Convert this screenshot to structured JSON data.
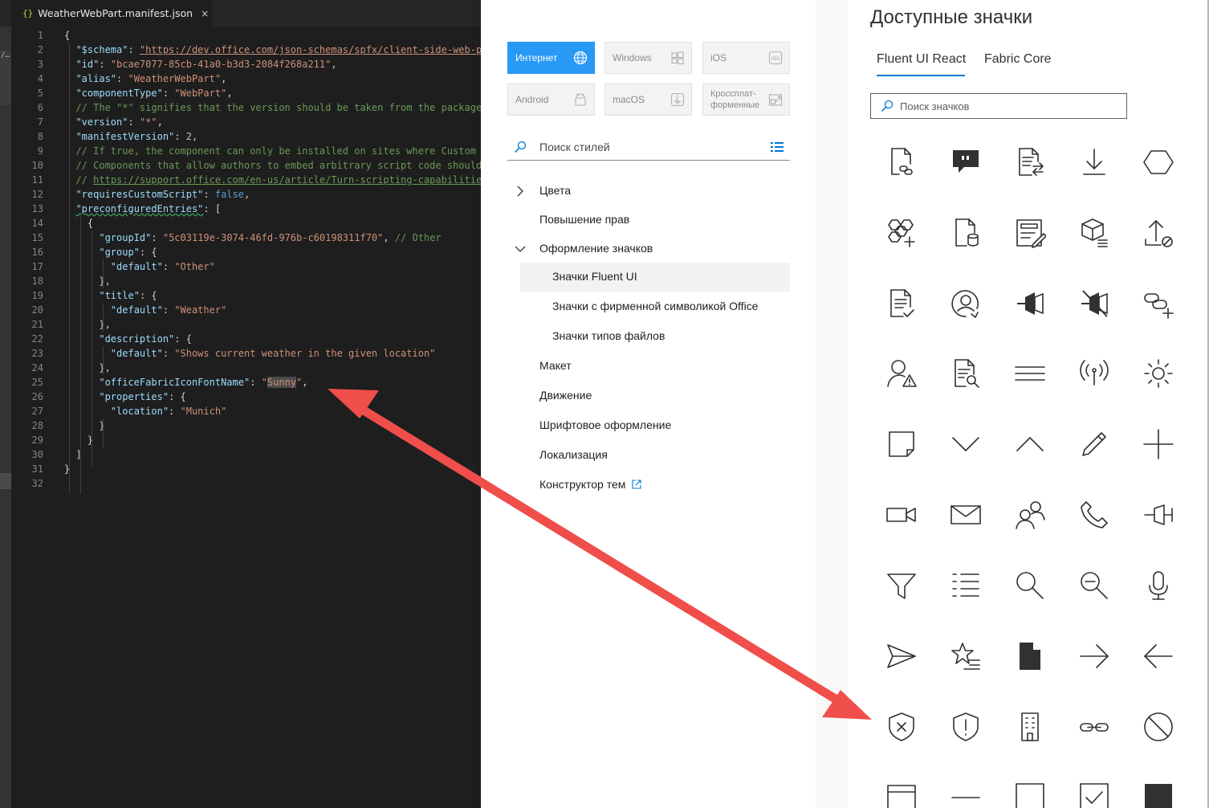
{
  "editor": {
    "tab": {
      "icon": "{}",
      "title": "WeatherWebPart.manifest.json",
      "close": "×"
    },
    "activity_mark": "/…",
    "lines": [
      {
        "n": "1",
        "t": [
          [
            "pun",
            "{"
          ]
        ]
      },
      {
        "n": "2",
        "t": [
          [
            "pun",
            "  "
          ],
          [
            "key",
            "\"$schema\""
          ],
          [
            "pun",
            ": "
          ],
          [
            "lnk",
            "\"https://dev.office.com/json-schemas/spfx/client-side-web-p"
          ]
        ]
      },
      {
        "n": "3",
        "t": [
          [
            "pun",
            "  "
          ],
          [
            "key",
            "\"id\""
          ],
          [
            "pun",
            ": "
          ],
          [
            "str",
            "\"bcae7077-85cb-41a0-b3d3-2084f268a211\""
          ],
          [
            "pun",
            ","
          ]
        ]
      },
      {
        "n": "4",
        "t": [
          [
            "pun",
            "  "
          ],
          [
            "key",
            "\"alias\""
          ],
          [
            "pun",
            ": "
          ],
          [
            "str",
            "\"WeatherWebPart\""
          ],
          [
            "pun",
            ","
          ]
        ]
      },
      {
        "n": "5",
        "t": [
          [
            "pun",
            "  "
          ],
          [
            "key",
            "\"componentType\""
          ],
          [
            "pun",
            ": "
          ],
          [
            "str",
            "\"WebPart\""
          ],
          [
            "pun",
            ","
          ]
        ]
      },
      {
        "n": "6",
        "t": [
          [
            "pun",
            "  "
          ],
          [
            "cmt",
            "// The \"*\" signifies that the version should be taken from the package"
          ]
        ]
      },
      {
        "n": "7",
        "t": [
          [
            "pun",
            "  "
          ],
          [
            "key",
            "\"version\""
          ],
          [
            "pun",
            ": "
          ],
          [
            "str",
            "\"*\""
          ],
          [
            "pun",
            ","
          ]
        ]
      },
      {
        "n": "8",
        "t": [
          [
            "pun",
            "  "
          ],
          [
            "key",
            "\"manifestVersion\""
          ],
          [
            "pun",
            ": "
          ],
          [
            "num",
            "2"
          ],
          [
            "pun",
            ","
          ]
        ]
      },
      {
        "n": "9",
        "t": [
          [
            "pun",
            "  "
          ],
          [
            "cmt",
            "// If true, the component can only be installed on sites where Custom"
          ]
        ]
      },
      {
        "n": "10",
        "t": [
          [
            "pun",
            "  "
          ],
          [
            "cmt",
            "// Components that allow authors to embed arbitrary script code should"
          ]
        ]
      },
      {
        "n": "11",
        "t": [
          [
            "pun",
            "  "
          ],
          [
            "cmt",
            "// "
          ],
          [
            "cmtlnk",
            "https://support.office.com/en-us/article/Turn-scripting-capabilitie"
          ]
        ]
      },
      {
        "n": "12",
        "t": [
          [
            "pun",
            "  "
          ],
          [
            "key",
            "\"requiresCustomScript\""
          ],
          [
            "pun",
            ": "
          ],
          [
            "bool",
            "false"
          ],
          [
            "pun",
            ","
          ]
        ]
      },
      {
        "n": "13",
        "t": [
          [
            "pun",
            "  "
          ],
          [
            "keysq",
            "\"preconfiguredEntries\""
          ],
          [
            "pun",
            ": ["
          ]
        ]
      },
      {
        "n": "14",
        "t": [
          [
            "pun",
            "    {"
          ]
        ]
      },
      {
        "n": "15",
        "t": [
          [
            "pun",
            "      "
          ],
          [
            "key",
            "\"groupId\""
          ],
          [
            "pun",
            ": "
          ],
          [
            "str",
            "\"5c03119e-3074-46fd-976b-c60198311f70\""
          ],
          [
            "pun",
            ", "
          ],
          [
            "cmt",
            "// Other"
          ]
        ]
      },
      {
        "n": "16",
        "t": [
          [
            "pun",
            "      "
          ],
          [
            "key",
            "\"group\""
          ],
          [
            "pun",
            ": {"
          ]
        ]
      },
      {
        "n": "17",
        "t": [
          [
            "pun",
            "        "
          ],
          [
            "key",
            "\"default\""
          ],
          [
            "pun",
            ": "
          ],
          [
            "str",
            "\"Other\""
          ]
        ]
      },
      {
        "n": "18",
        "t": [
          [
            "pun",
            "      },"
          ]
        ]
      },
      {
        "n": "19",
        "t": [
          [
            "pun",
            "      "
          ],
          [
            "key",
            "\"title\""
          ],
          [
            "pun",
            ": {"
          ]
        ]
      },
      {
        "n": "20",
        "t": [
          [
            "pun",
            "        "
          ],
          [
            "key",
            "\"default\""
          ],
          [
            "pun",
            ": "
          ],
          [
            "str",
            "\"Weather\""
          ]
        ]
      },
      {
        "n": "21",
        "t": [
          [
            "pun",
            "      },"
          ]
        ]
      },
      {
        "n": "22",
        "t": [
          [
            "pun",
            "      "
          ],
          [
            "key",
            "\"description\""
          ],
          [
            "pun",
            ": {"
          ]
        ]
      },
      {
        "n": "23",
        "t": [
          [
            "pun",
            "        "
          ],
          [
            "key",
            "\"default\""
          ],
          [
            "pun",
            ": "
          ],
          [
            "str",
            "\"Shows current weather in the given location\""
          ]
        ]
      },
      {
        "n": "24",
        "t": [
          [
            "pun",
            "      },"
          ]
        ]
      },
      {
        "n": "25",
        "t": [
          [
            "pun",
            "      "
          ],
          [
            "key",
            "\"officeFabricIconFontName\""
          ],
          [
            "pun",
            ": "
          ],
          [
            "str",
            "\""
          ],
          [
            "strhl",
            "Sunny"
          ],
          [
            "str",
            "\""
          ],
          [
            "pun",
            ","
          ]
        ]
      },
      {
        "n": "26",
        "t": [
          [
            "pun",
            "      "
          ],
          [
            "key",
            "\"properties\""
          ],
          [
            "pun",
            ": {"
          ]
        ]
      },
      {
        "n": "27",
        "t": [
          [
            "pun",
            "        "
          ],
          [
            "key",
            "\"location\""
          ],
          [
            "pun",
            ": "
          ],
          [
            "str",
            "\"Munich\""
          ]
        ]
      },
      {
        "n": "28",
        "t": [
          [
            "pun",
            "      }"
          ]
        ]
      },
      {
        "n": "29",
        "t": [
          [
            "pun",
            "    }"
          ]
        ]
      },
      {
        "n": "30",
        "t": [
          [
            "pun",
            "  ]"
          ]
        ]
      },
      {
        "n": "31",
        "t": [
          [
            "pun",
            "}"
          ]
        ]
      },
      {
        "n": "32",
        "t": [
          [
            "pun",
            ""
          ]
        ]
      }
    ]
  },
  "style_panel": {
    "platforms": [
      {
        "name": "platform-web",
        "label": "Интернет",
        "icon": "globe-icon",
        "active": true
      },
      {
        "name": "platform-windows",
        "label": "Windows",
        "icon": "windows-icon",
        "active": false
      },
      {
        "name": "platform-ios",
        "label": "iOS",
        "icon": "ios-icon",
        "active": false
      },
      {
        "name": "platform-android",
        "label": "Android",
        "icon": "android-icon",
        "active": false
      },
      {
        "name": "platform-macos",
        "label": "macOS",
        "icon": "macos-icon",
        "active": false
      },
      {
        "name": "platform-cross",
        "label": "Кроссплат-\nформенные",
        "icon": "cross-platform-icon",
        "active": false
      }
    ],
    "search": {
      "placeholder": "Поиск стилей"
    },
    "nav": [
      {
        "id": "colors",
        "label": "Цвета",
        "chevron": "right",
        "level": 0,
        "selected": false
      },
      {
        "id": "elevation",
        "label": "Повышение прав",
        "chevron": "",
        "level": 0,
        "selected": false
      },
      {
        "id": "iconography",
        "label": "Оформление значков",
        "chevron": "down",
        "level": 0,
        "selected": false
      },
      {
        "id": "fluent-icons",
        "label": "Значки Fluent UI",
        "chevron": "",
        "level": 1,
        "selected": true
      },
      {
        "id": "office-brand-icons",
        "label": "Значки с фирменной символикой Office",
        "chevron": "",
        "level": 1,
        "selected": false
      },
      {
        "id": "file-type-icons",
        "label": "Значки типов файлов",
        "chevron": "",
        "level": 1,
        "selected": false
      },
      {
        "id": "layout",
        "label": "Макет",
        "chevron": "",
        "level": 0,
        "selected": false
      },
      {
        "id": "motion",
        "label": "Движение",
        "chevron": "",
        "level": 0,
        "selected": false
      },
      {
        "id": "typography",
        "label": "Шрифтовое оформление",
        "chevron": "",
        "level": 0,
        "selected": false
      },
      {
        "id": "localization",
        "label": "Локализация",
        "chevron": "",
        "level": 0,
        "selected": false
      },
      {
        "id": "theme-designer",
        "label": "Конструктор тем",
        "chevron": "",
        "level": 0,
        "selected": false,
        "external": true
      }
    ]
  },
  "icons_panel": {
    "title": "Доступные значки",
    "tabs": [
      {
        "label": "Fluent UI React",
        "active": true
      },
      {
        "label": "Fabric Core",
        "active": false
      }
    ],
    "search": {
      "placeholder": "Поиск значков"
    },
    "grid": [
      [
        "page-link-icon",
        "chat-comment-icon",
        "page-swap-icon",
        "download-icon",
        "hexagon-icon"
      ],
      [
        "shapes-add-icon",
        "page-database-icon",
        "edit-form-icon",
        "package-list-icon",
        "upload-blocked-icon"
      ],
      [
        "document-approval-icon",
        "contact-sync-icon",
        "pin-icon",
        "unpin-icon",
        "link-add-icon"
      ],
      [
        "person-warning-icon",
        "document-search-icon",
        "hamburger-menu-icon",
        "radio-signal-icon",
        "sunny-icon"
      ],
      [
        "sticky-note-icon",
        "chevron-down-icon",
        "chevron-up-icon",
        "edit-pencil-icon",
        "add-plus-icon"
      ],
      [
        "video-icon",
        "mail-icon",
        "people-icon",
        "phone-icon",
        "pushpin-icon"
      ],
      [
        "filter-icon",
        "bulleted-list-icon",
        "search-icon",
        "zoom-out-icon",
        "microphone-icon"
      ],
      [
        "send-icon",
        "favorite-list-icon",
        "page-solid-icon",
        "arrow-right-icon",
        "arrow-left-icon"
      ],
      [
        "shield-error-icon",
        "shield-alert-icon",
        "building-icon",
        "link-icon",
        "blocked-icon"
      ],
      [
        "window-icon",
        "remove-icon",
        "checkbox-icon",
        "checkbox-checked-icon",
        "square-solid-icon"
      ]
    ]
  },
  "colors": {
    "accent": "#2899f5",
    "tab_underline": "#0078d4",
    "arrow": "#f04e4b"
  }
}
